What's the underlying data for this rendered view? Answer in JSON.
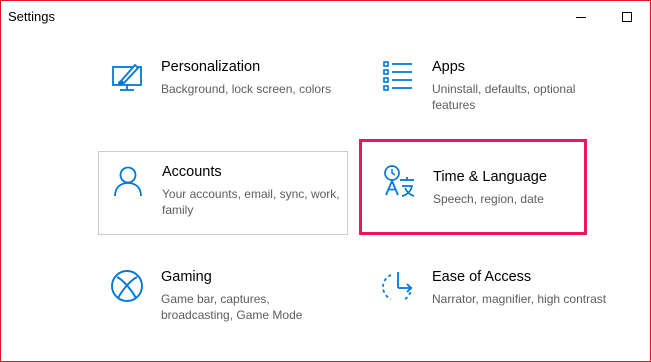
{
  "window": {
    "title": "Settings"
  },
  "tiles": [
    {
      "title": "Personalization",
      "description": "Background, lock screen, colors",
      "icon": "personalization-icon"
    },
    {
      "title": "Apps",
      "description": "Uninstall, defaults, optional features",
      "icon": "apps-icon"
    },
    {
      "title": "Accounts",
      "description": "Your accounts, email, sync, work, family",
      "icon": "accounts-icon"
    },
    {
      "title": "Time & Language",
      "description": "Speech, region, date",
      "icon": "time-language-icon"
    },
    {
      "title": "Gaming",
      "description": "Game bar, captures, broadcasting, Game Mode",
      "icon": "xbox-icon"
    },
    {
      "title": "Ease of Access",
      "description": "Narrator, magnifier, high contrast",
      "icon": "ease-of-access-icon"
    }
  ],
  "colors": {
    "accent": "#0078d7",
    "highlight": "#e8195a",
    "selected_border": "#cccccc",
    "window_border": "#e81123"
  }
}
